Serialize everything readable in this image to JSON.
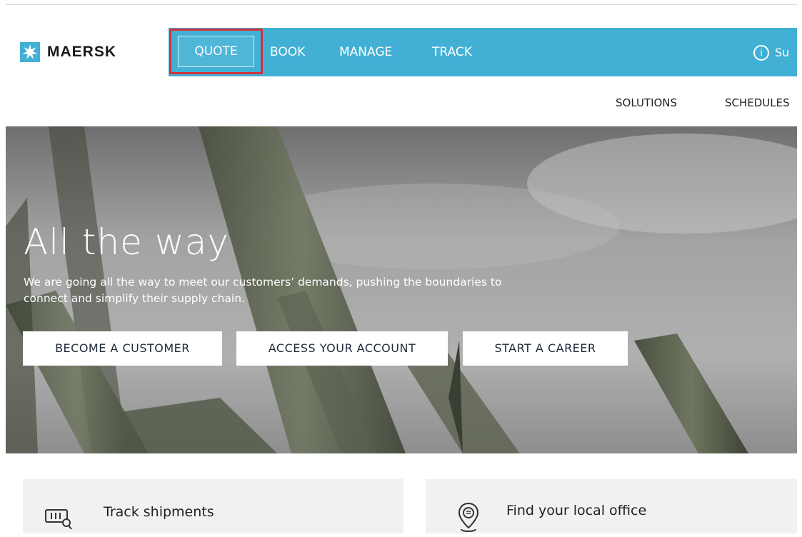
{
  "brand": {
    "name": "MAERSK",
    "color_primary": "#42b0d5",
    "highlight_color": "#d13239"
  },
  "nav": {
    "items": [
      "QUOTE",
      "BOOK",
      "MANAGE",
      "TRACK"
    ],
    "support_label": "Su"
  },
  "subnav": {
    "items": [
      "SOLUTIONS",
      "SCHEDULES"
    ]
  },
  "hero": {
    "title": "All the way",
    "line1": "We are going all the way to meet our customers’ demands, pushing the boundaries to",
    "line2": "connect and simplify their supply chain.",
    "buttons": [
      "BECOME A CUSTOMER",
      "ACCESS YOUR ACCOUNT",
      "START A CAREER"
    ]
  },
  "cards": [
    {
      "title": "Track shipments",
      "icon": "track-shipments-icon"
    },
    {
      "title": "Find your local office",
      "icon": "location-pin-icon"
    }
  ]
}
